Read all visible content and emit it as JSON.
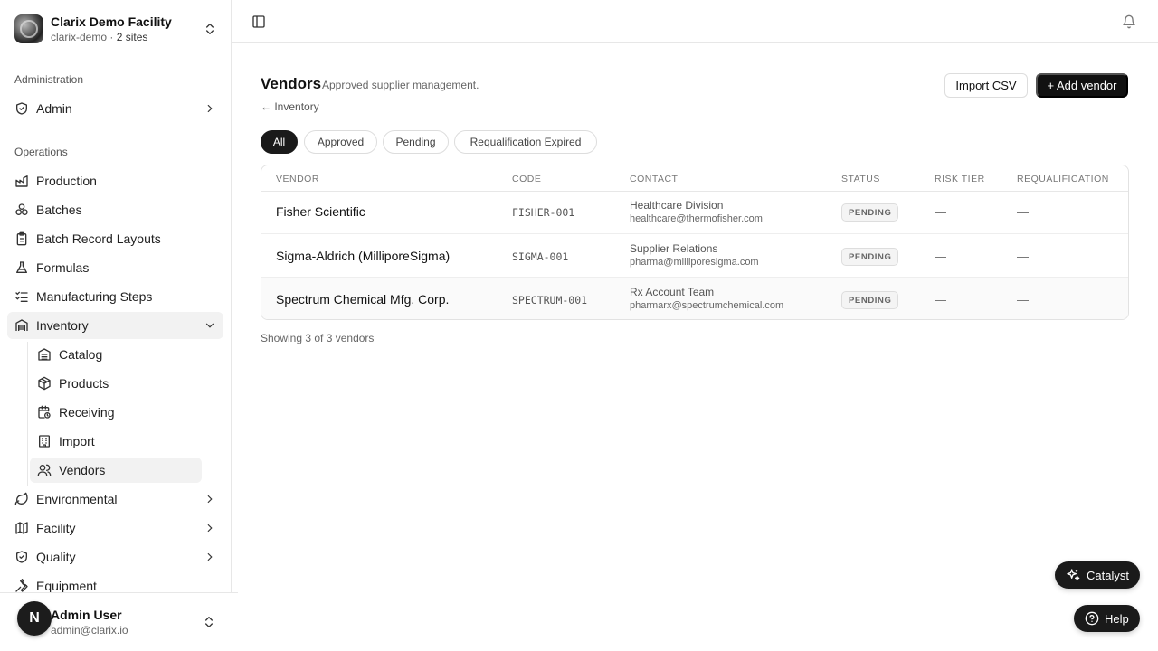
{
  "org": {
    "name": "Clarix Demo Facility",
    "slug": "clarix-demo",
    "separator": " · ",
    "sites": "2 sites"
  },
  "sidebar": {
    "admin_section": "Administration",
    "admin_item": "Admin",
    "ops_section": "Operations",
    "items": [
      {
        "label": "Production",
        "icon": "factory-icon"
      },
      {
        "label": "Batches",
        "icon": "batches-icon"
      },
      {
        "label": "Batch Record Layouts",
        "icon": "clipboard-icon"
      },
      {
        "label": "Formulas",
        "icon": "flask-icon"
      },
      {
        "label": "Manufacturing Steps",
        "icon": "list-checks-icon"
      },
      {
        "label": "Inventory",
        "icon": "warehouse-icon"
      }
    ],
    "inventory_sub": [
      {
        "label": "Catalog",
        "icon": "catalog-icon"
      },
      {
        "label": "Products",
        "icon": "package-icon"
      },
      {
        "label": "Receiving",
        "icon": "calendar-clock-icon"
      },
      {
        "label": "Import",
        "icon": "building-icon"
      },
      {
        "label": "Vendors",
        "icon": "users-icon"
      }
    ],
    "lower_items": [
      {
        "label": "Environmental",
        "icon": "leaf-icon"
      },
      {
        "label": "Facility",
        "icon": "map-icon"
      },
      {
        "label": "Quality",
        "icon": "shield-check-icon"
      },
      {
        "label": "Equipment",
        "icon": "wrench-icon"
      }
    ]
  },
  "user": {
    "initial": "N",
    "name": "Admin User",
    "email": "admin@clarix.io"
  },
  "page": {
    "title": "Vendors",
    "subtitle": "Approved supplier management.",
    "back": "← Inventory",
    "import_btn": "Import CSV",
    "add_btn": "+ Add vendor"
  },
  "filters": [
    "All",
    "Approved",
    "Pending",
    "Requalification Expired"
  ],
  "table": {
    "headers": [
      "Vendor",
      "Code",
      "Contact",
      "Status",
      "Risk Tier",
      "Requalification"
    ],
    "rows": [
      {
        "vendor": "Fisher Scientific",
        "code": "FISHER-001",
        "contact": "Healthcare Division",
        "email": "healthcare@thermofisher.com",
        "status": "PENDING",
        "risk": "—",
        "requal": "—"
      },
      {
        "vendor": "Sigma-Aldrich (MilliporeSigma)",
        "code": "SIGMA-001",
        "contact": "Supplier Relations",
        "email": "pharma@milliporesigma.com",
        "status": "PENDING",
        "risk": "—",
        "requal": "—"
      },
      {
        "vendor": "Spectrum Chemical Mfg. Corp.",
        "code": "SPECTRUM-001",
        "contact": "Rx Account Team",
        "email": "pharmarx@spectrumchemical.com",
        "status": "PENDING",
        "risk": "—",
        "requal": "—"
      }
    ]
  },
  "footnote": "Showing 3 of 3 vendors",
  "fab": {
    "catalyst": "Catalyst",
    "help": "Help"
  },
  "colors": {
    "accent": "#111111",
    "active_bg": "#f2f2f2",
    "border": "#e7e7e7"
  }
}
